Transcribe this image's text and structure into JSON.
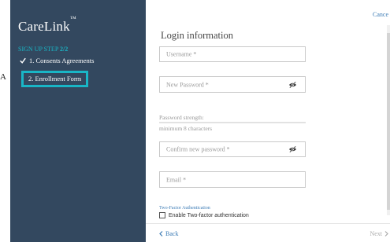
{
  "left_marker": "A",
  "sidebar": {
    "logo": "CareLink",
    "logo_mark": "™",
    "step_prefix": "SIGN UP STEP",
    "step_number": "2/2",
    "steps": [
      {
        "label": "1. Consents Agreements",
        "state": "done"
      },
      {
        "label": "2. Enrollment Form",
        "state": "current"
      }
    ]
  },
  "header": {
    "cancel_label": "Cance"
  },
  "form": {
    "title": "Login information",
    "username_placeholder": "Username *",
    "new_password_placeholder": "New Password *",
    "password_strength_label": "Password strength:",
    "password_hint": "minimum 8 characters",
    "confirm_password_placeholder": "Confirm new password *",
    "email_placeholder": "Email *",
    "tfa_heading": "Two-Factor Authentication",
    "tfa_checkbox_label": "Enable Two-factor authentication",
    "tfa_enabled": false
  },
  "footer": {
    "back_label": "Back",
    "next_label": "Next"
  },
  "colors": {
    "sidebar": "#33485f",
    "accent": "#19b6c6",
    "link": "#3b7bb5"
  }
}
